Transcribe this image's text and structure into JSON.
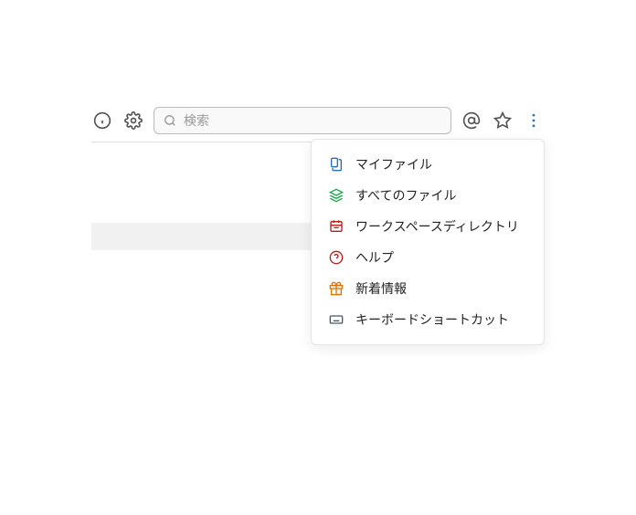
{
  "search": {
    "placeholder": "検索"
  },
  "menu": {
    "items": [
      {
        "label": "マイファイル"
      },
      {
        "label": "すべてのファイル"
      },
      {
        "label": "ワークスペースディレクトリ"
      },
      {
        "label": "ヘルプ"
      },
      {
        "label": "新着情報"
      },
      {
        "label": "キーボードショートカット"
      }
    ]
  },
  "icons": {
    "info": "info-icon",
    "settings": "gear-icon",
    "mention": "at-icon",
    "star": "star-icon",
    "more": "more-vertical-icon"
  },
  "colors": {
    "myfiles": "#2b6cb0",
    "allfiles": "#16a34a",
    "directory": "#b91c1c",
    "help": "#b91c1c",
    "whatsnew": "#d97706",
    "keyboard": "#4b5563"
  }
}
